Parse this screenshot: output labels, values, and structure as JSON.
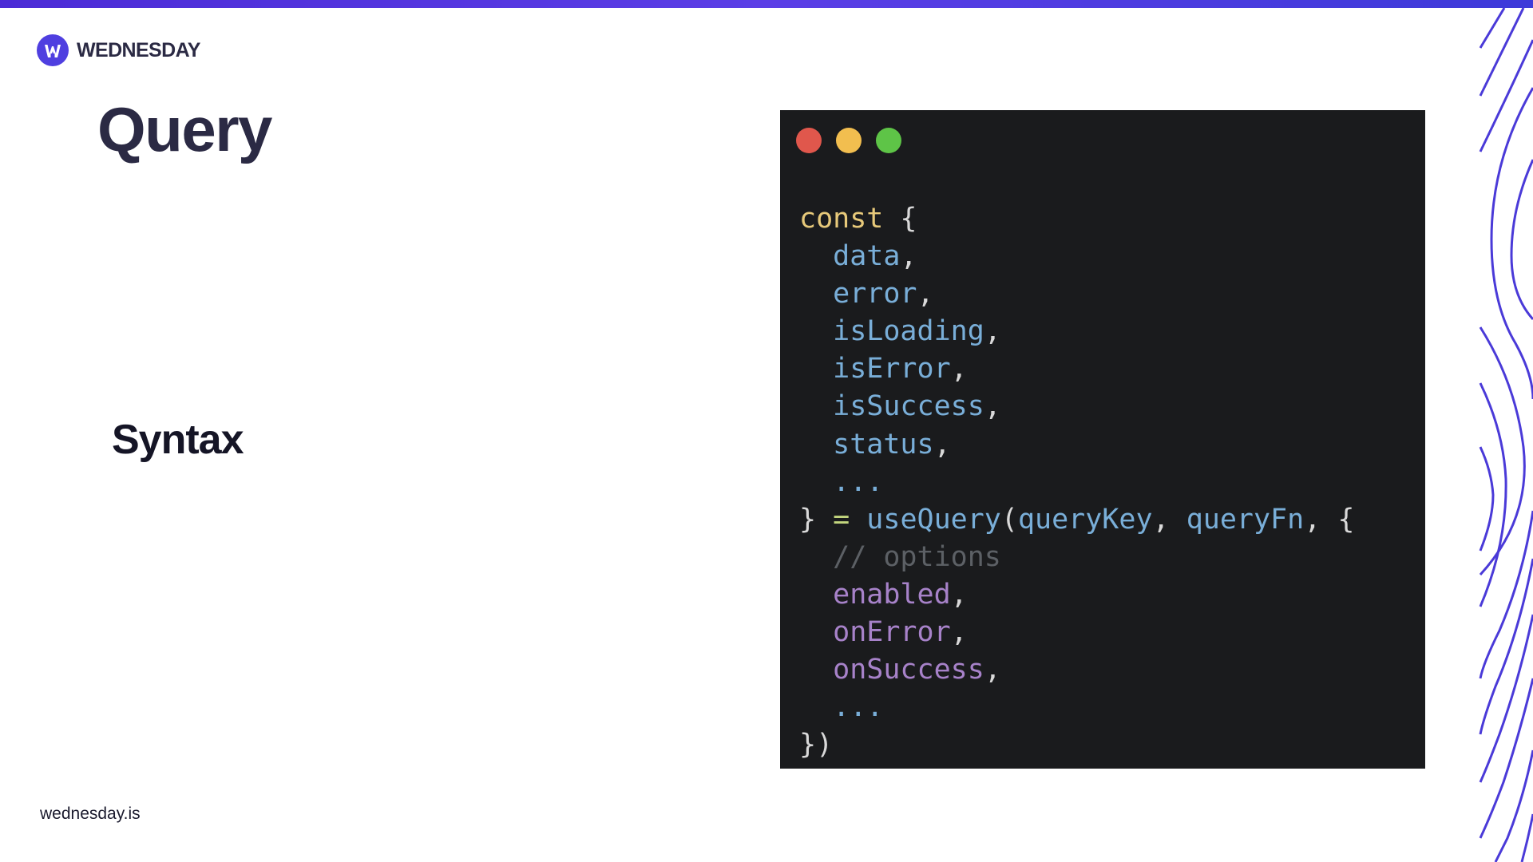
{
  "brand": {
    "name": "WEDNESDAY",
    "logo_icon": "wednesday-logo-icon",
    "accent_color": "#4f3fe0"
  },
  "slide": {
    "title": "Query",
    "subtitle": "Syntax",
    "footer": "wednesday.is"
  },
  "code_window": {
    "traffic_lights": [
      {
        "name": "close",
        "color": "#e0574c"
      },
      {
        "name": "minimize",
        "color": "#f2be4f"
      },
      {
        "name": "maximize",
        "color": "#5ec447"
      }
    ],
    "theme": {
      "background": "#1a1b1d",
      "keyword": "#e7c97a",
      "identifier": "#79aed8",
      "property": "#a782c9",
      "operator": "#c3d67e",
      "comment": "#5c6065",
      "punctuation": "#d9d9d9"
    },
    "lines": [
      [
        {
          "t": "const",
          "c": "keyword"
        },
        {
          "t": " {",
          "c": "punctuation"
        }
      ],
      [
        {
          "t": "  data",
          "c": "identifier"
        },
        {
          "t": ",",
          "c": "punctuation"
        }
      ],
      [
        {
          "t": "  error",
          "c": "identifier"
        },
        {
          "t": ",",
          "c": "punctuation"
        }
      ],
      [
        {
          "t": "  isLoading",
          "c": "identifier"
        },
        {
          "t": ",",
          "c": "punctuation"
        }
      ],
      [
        {
          "t": "  isError",
          "c": "identifier"
        },
        {
          "t": ",",
          "c": "punctuation"
        }
      ],
      [
        {
          "t": "  isSuccess",
          "c": "identifier"
        },
        {
          "t": ",",
          "c": "punctuation"
        }
      ],
      [
        {
          "t": "  status",
          "c": "identifier"
        },
        {
          "t": ",",
          "c": "punctuation"
        }
      ],
      [
        {
          "t": "  ...",
          "c": "identifier"
        }
      ],
      [
        {
          "t": "}",
          "c": "punctuation"
        },
        {
          "t": " = ",
          "c": "operator"
        },
        {
          "t": "useQuery",
          "c": "identifier"
        },
        {
          "t": "(",
          "c": "punctuation"
        },
        {
          "t": "queryKey",
          "c": "identifier"
        },
        {
          "t": ", ",
          "c": "punctuation"
        },
        {
          "t": "queryFn",
          "c": "identifier"
        },
        {
          "t": ", {",
          "c": "punctuation"
        }
      ],
      [
        {
          "t": "  // options",
          "c": "comment"
        }
      ],
      [
        {
          "t": "  enabled",
          "c": "property"
        },
        {
          "t": ",",
          "c": "punctuation"
        }
      ],
      [
        {
          "t": "  onError",
          "c": "property"
        },
        {
          "t": ",",
          "c": "punctuation"
        }
      ],
      [
        {
          "t": "  onSuccess",
          "c": "property"
        },
        {
          "t": ",",
          "c": "punctuation"
        }
      ],
      [
        {
          "t": "  ...",
          "c": "identifier"
        }
      ],
      [
        {
          "t": "})",
          "c": "punctuation"
        }
      ]
    ]
  },
  "decoration": {
    "icon": "wavy-lines-decoration",
    "color": "#4a3ad8"
  }
}
